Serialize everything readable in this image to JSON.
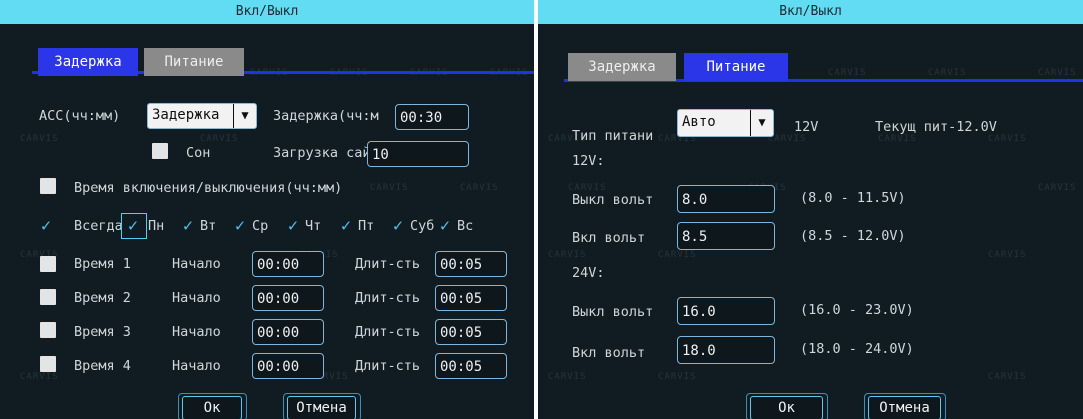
{
  "left": {
    "title": "Вкл/Выкл",
    "tabs": [
      "Задержка",
      "Питание"
    ],
    "acc_label": "ACC(чч:мм)",
    "acc_select": "Задержка",
    "delay_label": "Задержка(чч:м",
    "delay_value": "00:30",
    "sleep_label": "Сон",
    "upload_label": "Загрузка сайт",
    "upload_value": "10",
    "onoff_time_label": "Время включения/выключения(чч:мм)",
    "days": [
      "Всегда",
      "Пн",
      "Вт",
      "Ср",
      "Чт",
      "Пт",
      "Суб",
      "Вс"
    ],
    "time_rows": [
      {
        "label": "Время 1",
        "start_label": "Начало",
        "start": "00:00",
        "dur_label": "Длит-сть",
        "dur": "00:05"
      },
      {
        "label": "Время 2",
        "start_label": "Начало",
        "start": "00:00",
        "dur_label": "Длит-сть",
        "dur": "00:05"
      },
      {
        "label": "Время 3",
        "start_label": "Начало",
        "start": "00:00",
        "dur_label": "Длит-сть",
        "dur": "00:05"
      },
      {
        "label": "Время 4",
        "start_label": "Начало",
        "start": "00:00",
        "dur_label": "Длит-сть",
        "dur": "00:05"
      }
    ],
    "ok_label": "Ок",
    "cancel_label": "Отмена"
  },
  "right": {
    "title": "Вкл/Выкл",
    "tabs": [
      "Задержка",
      "Питание"
    ],
    "power_type_label": "Тип питани",
    "power_type_value": "Авто",
    "power_voltage": "12V",
    "current_power": "Текущ пит-12.0V",
    "sec12_label": "12V:",
    "sec24_label": "24V:",
    "rows": [
      {
        "label": "Выкл вольт",
        "value": "8.0",
        "range": "(8.0 - 11.5V)"
      },
      {
        "label": "Вкл вольт",
        "value": "8.5",
        "range": "(8.5 - 12.0V)"
      },
      {
        "label": "Выкл вольт",
        "value": "16.0",
        "range": "(16.0 - 23.0V)"
      },
      {
        "label": "Вкл вольт",
        "value": "18.0",
        "range": "(18.0 - 24.0V)"
      }
    ],
    "ok_label": "Ок",
    "cancel_label": "Отмена"
  },
  "watermark": "CARVIS",
  "colors": {
    "panel_bg": "#101c22",
    "title_bar": "#62dcf3",
    "active_tab": "#2a36e8",
    "inactive_tab": "#8a8a8a",
    "field_border": "#7eb6dd",
    "check": "#4cc0f0"
  }
}
